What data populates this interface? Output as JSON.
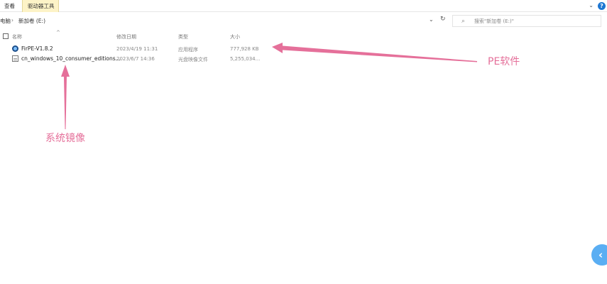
{
  "ribbon": {
    "tab_view": "查看",
    "tab_drive_tools": "驱动器工具"
  },
  "address": {
    "root": "电脑",
    "separator": "›",
    "drive": "新加卷 (E:)",
    "dropdown": "⌄",
    "refresh": "↻"
  },
  "search": {
    "placeholder": "搜索\"新加卷 (E:)\""
  },
  "columns": {
    "name": "名称",
    "modified": "修改日期",
    "type": "类型",
    "size": "大小"
  },
  "files": [
    {
      "name": "FirPE-V1.8.2",
      "modified": "2023/4/19 11:31",
      "type": "应用程序",
      "size": "777,928 KB",
      "icon": "app-icon"
    },
    {
      "name": "cn_windows_10_consumer_editions...",
      "modified": "2023/6/7 14:36",
      "type": "光盘映像文件",
      "size": "5,255,034...",
      "icon": "disc-image-icon"
    }
  ],
  "annotations": {
    "pe_label": "PE软件",
    "image_label": "系统镜像",
    "color": "#e5709a"
  },
  "icons": {
    "help": "?",
    "collapse": "⌄",
    "sort": "^",
    "search": "⌕",
    "side_tab": "‹"
  }
}
